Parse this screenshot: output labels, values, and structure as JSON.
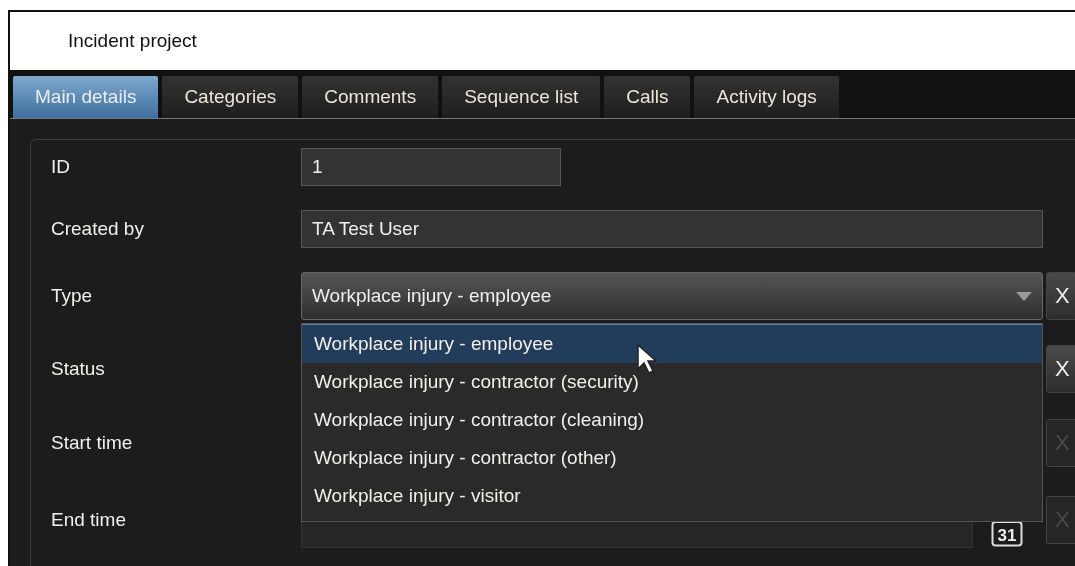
{
  "window": {
    "title": "Incident project"
  },
  "tabs": [
    {
      "label": "Main details",
      "selected": true
    },
    {
      "label": "Categories",
      "selected": false
    },
    {
      "label": "Comments",
      "selected": false
    },
    {
      "label": "Sequence list",
      "selected": false
    },
    {
      "label": "Calls",
      "selected": false
    },
    {
      "label": "Activity logs",
      "selected": false
    }
  ],
  "fields": [
    {
      "label": "ID",
      "kind": "short",
      "value": "1"
    },
    {
      "label": "Created by",
      "kind": "text",
      "value": "TA Test User"
    },
    {
      "label": "Type",
      "kind": "combo",
      "value": "Workplace injury - employee",
      "clear": {
        "label": "X",
        "disabled": false
      }
    },
    {
      "label": "Status",
      "kind": "hidden",
      "clear": {
        "label": "X",
        "disabled": false
      }
    },
    {
      "label": "Start time",
      "kind": "hidden",
      "clear": {
        "label": "X",
        "disabled": true
      }
    },
    {
      "label": "End time",
      "kind": "date",
      "calendar": "31",
      "clear": {
        "label": "X",
        "disabled": true
      }
    }
  ],
  "dropdown": {
    "options": [
      {
        "label": "Workplace injury - employee",
        "selected": true
      },
      {
        "label": "Workplace injury - contractor (security)",
        "selected": false
      },
      {
        "label": "Workplace injury - contractor (cleaning)",
        "selected": false
      },
      {
        "label": "Workplace injury - contractor (other)",
        "selected": false
      },
      {
        "label": "Workplace injury - visitor",
        "selected": false
      }
    ]
  }
}
